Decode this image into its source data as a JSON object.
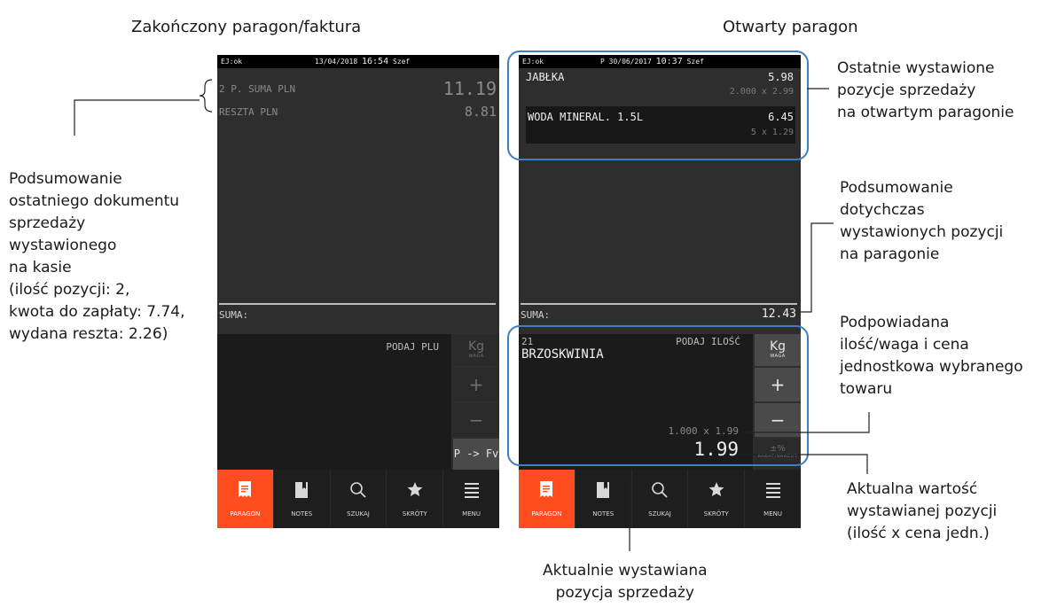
{
  "headings": {
    "left": "Zakończony paragon/faktura",
    "right": "Otwarty paragon"
  },
  "left_screen": {
    "status": {
      "ej": "EJ:ok",
      "date": "13/04/2018",
      "time": "16:54",
      "user": "Szef"
    },
    "summary_lines": [
      {
        "label": "2 P. SUMA PLN",
        "value": "11.19"
      },
      {
        "label": "RESZTA PLN",
        "value": "8.81"
      }
    ],
    "suma_label": "SUMA:",
    "prompt": "PODAJ PLU",
    "side_buttons": {
      "kg": "Kg",
      "kg_sub": "WAGA",
      "plus": "+",
      "minus": "−",
      "pfv": "P -> Fv"
    }
  },
  "right_screen": {
    "status": {
      "ej": "EJ:ok",
      "date": "P 30/06/2017",
      "time": "10:37",
      "user": "Szef"
    },
    "items": [
      {
        "name": "JABŁKA",
        "total": "5.98",
        "qty_price": "2.000 x 2.99"
      },
      {
        "name": "WODA MINERAL. 1.5L",
        "total": "6.45",
        "qty_price": "5 x 1.29"
      }
    ],
    "suma_label": "SUMA:",
    "suma_value": "12.43",
    "plu": "21",
    "prompt": "PODAJ ILOŚĆ",
    "product": "BRZOSKWINIA",
    "qty_price": "1.000 x 1.99",
    "value": "1.99",
    "side_buttons": {
      "kg": "Kg",
      "kg_sub": "WAGA",
      "plus": "+",
      "minus": "−",
      "percent": "±%",
      "percent_sub": "RABAT/NARZUT"
    }
  },
  "nav": [
    {
      "label": "PARAGON",
      "icon": "receipt-icon"
    },
    {
      "label": "NOTES",
      "icon": "bookmark-icon"
    },
    {
      "label": "SZUKAJ",
      "icon": "search-icon"
    },
    {
      "label": "SKRÓTY",
      "icon": "star-icon"
    },
    {
      "label": "MENU",
      "icon": "menu-icon"
    }
  ],
  "callouts": {
    "left": [
      "Podsumowanie",
      "ostatniego dokumentu",
      "sprzedaży",
      "wystawionego",
      "na kasie",
      "(ilość pozycji: 2,",
      "kwota do zapłaty: 7.74,",
      "wydana reszta: 2.26)"
    ],
    "items": [
      "Ostatnie wystawione",
      "pozycje sprzedaży",
      "na otwartym paragonie"
    ],
    "summary": [
      "Podsumowanie",
      "dotychczas",
      "wystawionych pozycji",
      "na paragonie"
    ],
    "suggested": [
      "Podpowiadana",
      "ilość/waga i cena",
      "jednostkowa wybranego",
      "towaru"
    ],
    "current_value": [
      "Aktualna wartość",
      "wystawianej pozycji",
      "(ilość x cena jedn.)"
    ],
    "current_item": [
      "Aktualnie wystawiana",
      "pozycja sprzedaży"
    ]
  },
  "colors": {
    "accent": "#ff4d1f",
    "highlight": "#3d7fc4",
    "screen_bg": "#2e2e2e"
  }
}
